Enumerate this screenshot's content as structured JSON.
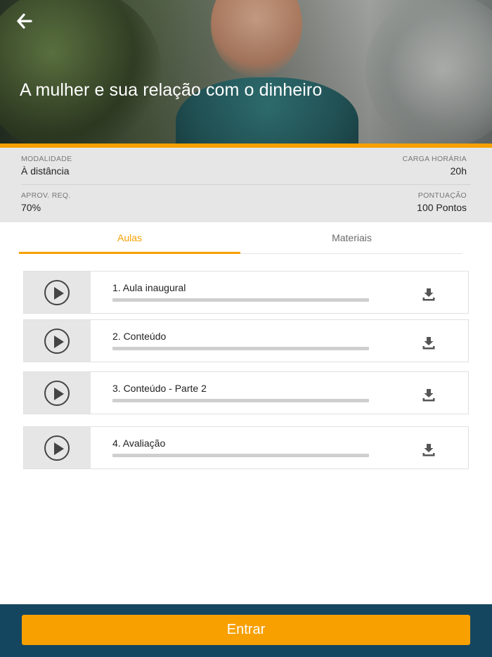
{
  "hero": {
    "title": "A mulher e sua relação com o dinheiro"
  },
  "info": {
    "modalidade_label": "MODALIDADE",
    "modalidade_value": "À distância",
    "carga_label": "CARGA HORÁRIA",
    "carga_value": "20h",
    "aprov_label": "APROV. REQ.",
    "aprov_value": "70%",
    "pontuacao_label": "PONTUAÇÃO",
    "pontuacao_value": "100 Pontos"
  },
  "tabs": [
    {
      "label": "Aulas",
      "active": true
    },
    {
      "label": "Materiais",
      "active": false
    }
  ],
  "lessons": [
    {
      "title": "1. Aula inaugural",
      "progress": 0
    },
    {
      "title": "2. Conteúdo",
      "progress": 0
    },
    {
      "title": "3. Conteúdo - Parte 2",
      "progress": 0
    },
    {
      "title": "4. Avaliação",
      "progress": 0
    }
  ],
  "footer": {
    "enter_label": "Entrar"
  },
  "colors": {
    "accent": "#f7a000",
    "footer_bg": "#15465f",
    "info_bg": "#e6e6e6"
  },
  "icons": {
    "back": "arrow-left-icon",
    "play": "play-circle-icon",
    "download": "download-icon"
  }
}
